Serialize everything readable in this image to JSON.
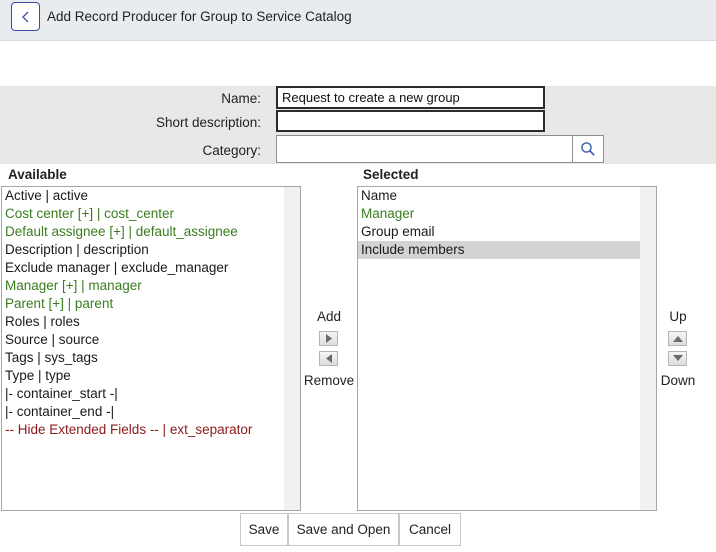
{
  "header": {
    "title": "Add Record Producer for Group to Service Catalog",
    "back_icon": "chevron-left-icon"
  },
  "form": {
    "name_label": "Name:",
    "name_value": "Request to create a new group",
    "short_label": "Short description:",
    "short_value": "",
    "category_label": "Category:",
    "category_value": ""
  },
  "slushbucket": {
    "available_label": "Available",
    "selected_label": "Selected",
    "available": [
      {
        "label": "Active | active",
        "kind": "field"
      },
      {
        "label": "Cost center [+] | cost_center",
        "kind": "reference"
      },
      {
        "label": "Default assignee [+] | default_assignee",
        "kind": "reference"
      },
      {
        "label": "Description | description",
        "kind": "field"
      },
      {
        "label": "Exclude manager | exclude_manager",
        "kind": "field"
      },
      {
        "label": "Manager [+] | manager",
        "kind": "reference"
      },
      {
        "label": "Parent [+] | parent",
        "kind": "reference"
      },
      {
        "label": "Roles | roles",
        "kind": "field"
      },
      {
        "label": "Source | source",
        "kind": "field"
      },
      {
        "label": "Tags | sys_tags",
        "kind": "field"
      },
      {
        "label": "Type | type",
        "kind": "field"
      },
      {
        "label": "|- container_start -|",
        "kind": "field"
      },
      {
        "label": "|- container_end -|",
        "kind": "field"
      },
      {
        "label": "-- Hide Extended Fields -- | ext_separator",
        "kind": "extended"
      }
    ],
    "selected": [
      {
        "label": "Name",
        "kind": "field",
        "highlighted": false
      },
      {
        "label": "Manager",
        "kind": "reference",
        "highlighted": false
      },
      {
        "label": "Group email",
        "kind": "field",
        "highlighted": false
      },
      {
        "label": "Include members",
        "kind": "field",
        "highlighted": true
      }
    ],
    "add_label": "Add",
    "remove_label": "Remove",
    "up_label": "Up",
    "down_label": "Down"
  },
  "buttons": {
    "save": "Save",
    "save_open": "Save and Open",
    "cancel": "Cancel"
  },
  "colors": {
    "reference_field": "#3a7d1f",
    "extended_field": "#8b1a1a",
    "back_button_border": "#3b4f9e",
    "search_icon": "#3b5aa8"
  }
}
